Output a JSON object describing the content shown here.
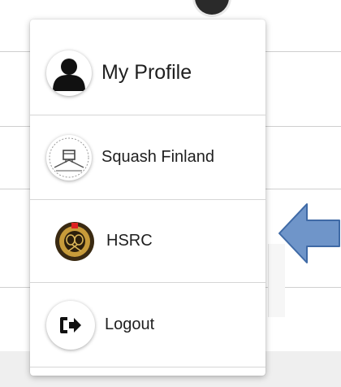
{
  "menu": {
    "items": [
      {
        "label": "My Profile",
        "icon": "person-icon"
      },
      {
        "label": "Squash Finland",
        "icon": "squash-finland-logo-icon"
      },
      {
        "label": "HSRC",
        "icon": "hsrc-logo-icon"
      },
      {
        "label": "Logout",
        "icon": "logout-icon"
      }
    ]
  },
  "annotation": {
    "arrow_color": "#6f95c9",
    "arrow_direction": "left"
  },
  "colors": {
    "menu_background": "#ffffff",
    "divider": "#d6d6d6",
    "text": "#1f1f1f",
    "hsrc_ring": "#caa240"
  }
}
